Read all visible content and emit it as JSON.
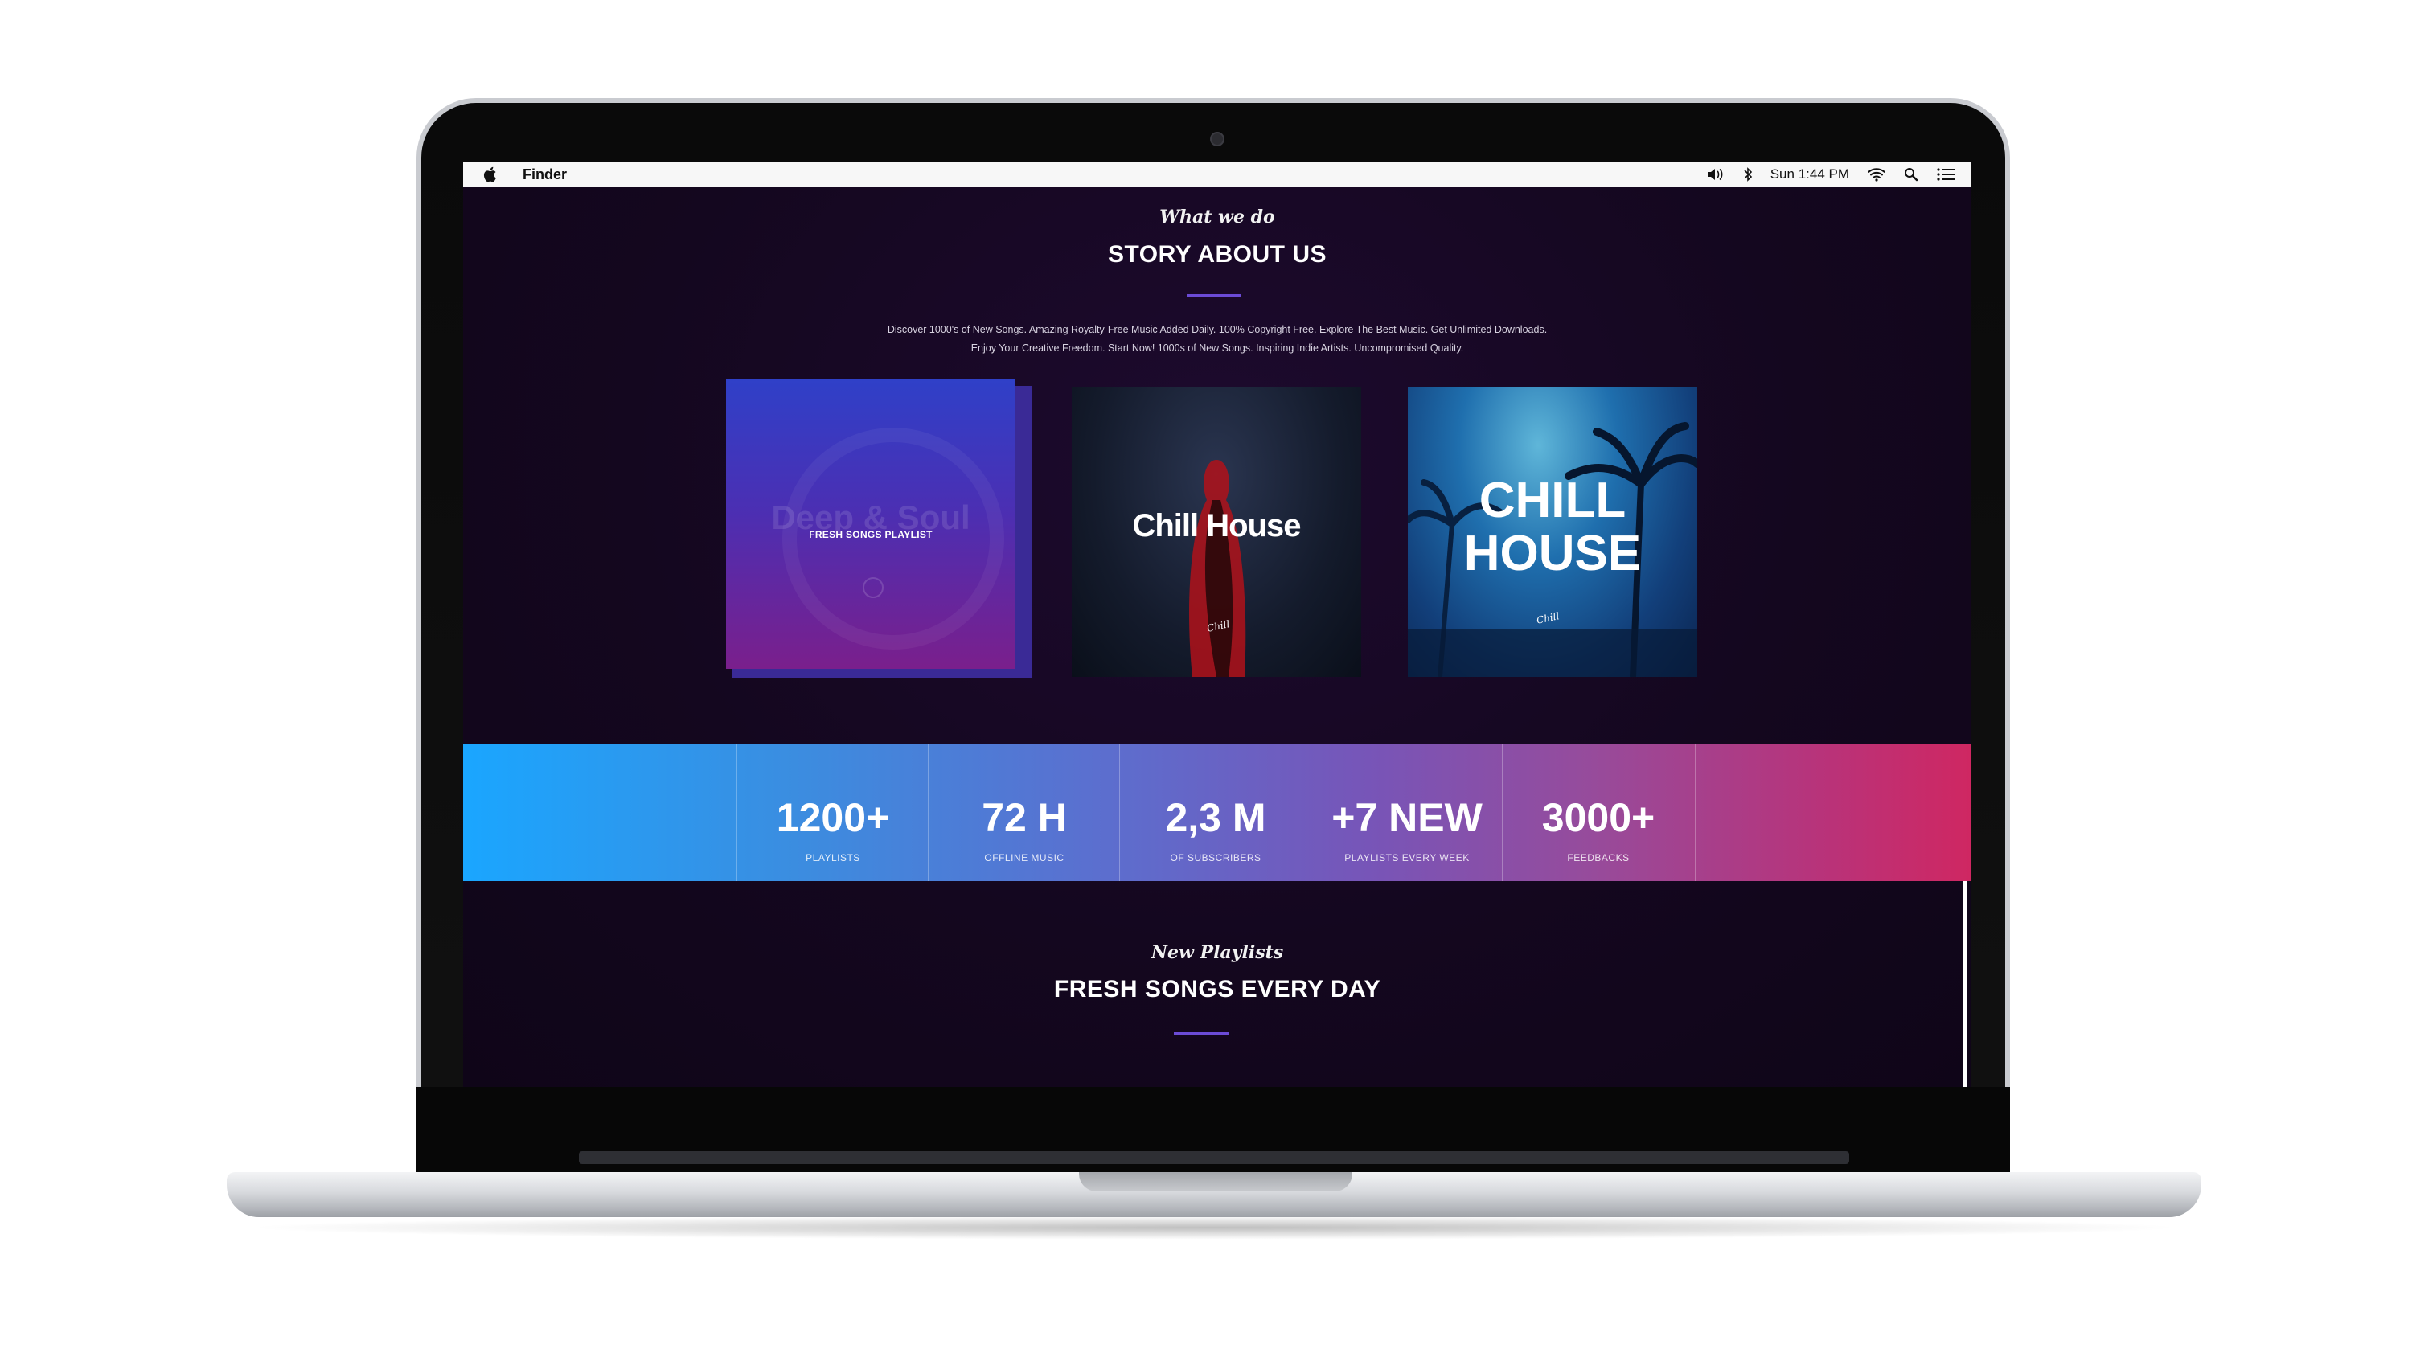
{
  "menubar": {
    "app_name": "Finder",
    "clock": "Sun 1:44 PM",
    "icons": [
      "apple-icon",
      "volume-icon",
      "bluetooth-icon",
      "wifi-icon",
      "search-icon",
      "list-icon"
    ]
  },
  "about": {
    "script_title": "What we do",
    "heading": "STORY ABOUT US",
    "intro_line_1": "Discover 1000's of New Songs. Amazing Royalty-Free Music Added Daily. 100% Copyright Free. Explore The Best Music. Get Unlimited Downloads.",
    "intro_line_2": "Enjoy Your Creative Freedom. Start Now! 1000s of New Songs. Inspiring Indie Artists. Uncompromised Quality."
  },
  "albums": [
    {
      "ghost_title": "Deep & Soul",
      "label": "FRESH SONGS PLAYLIST"
    },
    {
      "title": "Chill House"
    },
    {
      "title_line_1": "CHILL",
      "title_line_2": "HOUSE"
    }
  ],
  "stats": [
    {
      "value": "1200+",
      "label": "PLAYLISTS"
    },
    {
      "value": "72 H",
      "label": "OFFLINE MUSIC"
    },
    {
      "value": "2,3 M",
      "label": "OF SUBSCRIBERS"
    },
    {
      "value": "+7 NEW",
      "label": "PLAYLISTS EVERY WEEK"
    },
    {
      "value": "3000+",
      "label": "FEEDBACKS"
    }
  ],
  "playlists": {
    "script_title": "New Playlists",
    "heading": "FRESH SONGS EVERY DAY"
  },
  "colors": {
    "accent": "#6b4bd6",
    "banner_start": "#1aa6ff",
    "banner_end": "#cf2762",
    "background": "#14071f"
  }
}
